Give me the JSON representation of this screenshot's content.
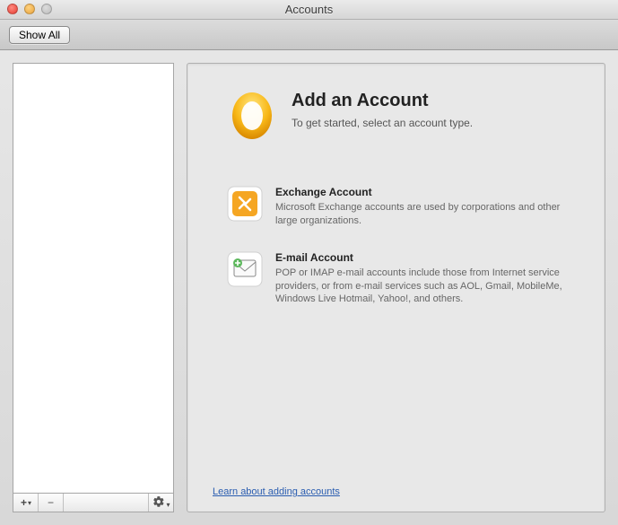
{
  "window": {
    "title": "Accounts"
  },
  "toolbar": {
    "show_all": "Show All"
  },
  "sidebar": {
    "add_label": "+",
    "remove_label": "−",
    "gear_label": "✿"
  },
  "main": {
    "hero": {
      "title": "Add an Account",
      "subtitle": "To get started, select an account type."
    },
    "exchange": {
      "title": "Exchange Account",
      "desc": "Microsoft Exchange accounts are used by corporations and other large organizations."
    },
    "email": {
      "title": "E-mail Account",
      "desc": "POP or IMAP e-mail accounts include those from Internet service providers, or from e-mail services such as AOL, Gmail, MobileMe, Windows Live Hotmail, Yahoo!, and others."
    },
    "learn_link": "Learn about adding accounts"
  }
}
